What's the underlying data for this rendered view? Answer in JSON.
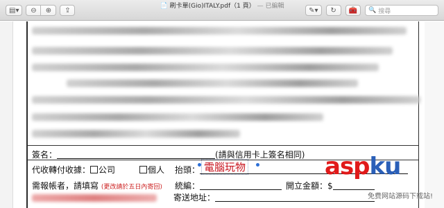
{
  "window": {
    "title": "刷卡單(Gio)ITALY.pdf（1 頁）",
    "edited": "— 已編輯"
  },
  "toolbar": {
    "search_placeholder": "搜尋"
  },
  "form": {
    "signature_label": "簽名：",
    "signature_note": "(請與信用卡上簽名相同)",
    "receipt_label": "代收轉付收據：",
    "company": "公司",
    "personal": "個人",
    "header_label": "抬頭：",
    "header_value": "電腦玩物",
    "report_label": "需報帳者，請填寫",
    "report_note": "(更改請於五日內寄回)",
    "tax_id_label": "統編：",
    "invoice_amount_label": "開立金額：",
    "currency": "$",
    "address_label": "寄送地址："
  },
  "watermark": {
    "asp": "asp",
    "ku": "ku",
    "tagline": "免费网站源码下载站!"
  }
}
